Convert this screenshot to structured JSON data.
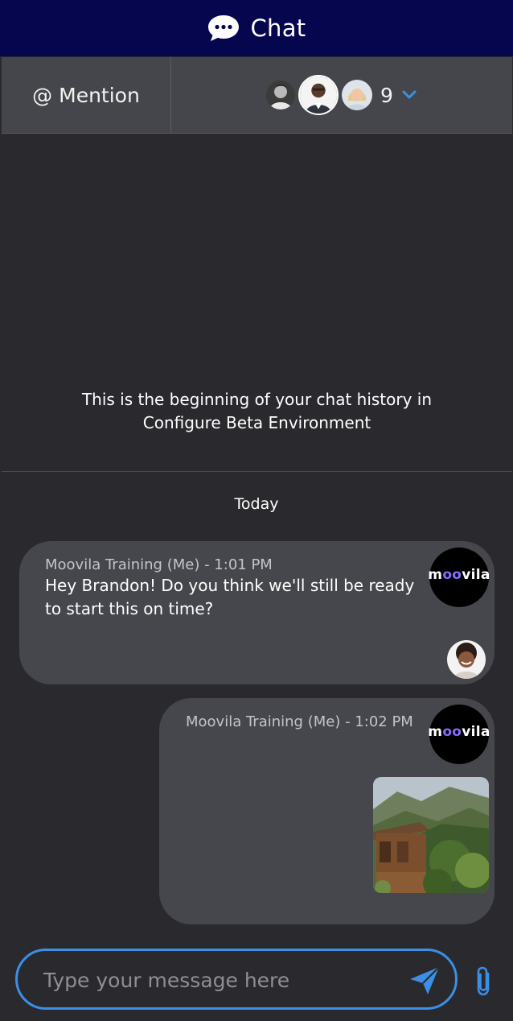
{
  "header": {
    "title": "Chat",
    "icon": "chat-bubble-icon"
  },
  "toolbar": {
    "mention_label": "@ Mention",
    "participant_count": "9",
    "chevron_icon": "chevron-down-icon"
  },
  "history": {
    "line1": "This is the beginning of your chat history in",
    "line2": "Configure Beta Environment"
  },
  "divider_label": "Today",
  "brand_logo": {
    "main_a": "m",
    "main_oo": "oo",
    "main_b": "vila"
  },
  "messages": [
    {
      "meta": "Moovila Training (Me) - 1:01 PM",
      "line1": "Hey Brandon! Do you think we'll still be ready",
      "line2": "to start this on time?"
    },
    {
      "meta": "Moovila Training (Me) - 1:02 PM",
      "attachment": "photo-cabin-image"
    }
  ],
  "composer": {
    "placeholder": "Type your message here",
    "send_icon": "send-icon",
    "attach_icon": "paperclip-icon"
  },
  "colors": {
    "header_bg": "#05064e",
    "accent": "#3b8fe6",
    "bubble_bg": "#46474c",
    "background": "#2a2a2e"
  }
}
